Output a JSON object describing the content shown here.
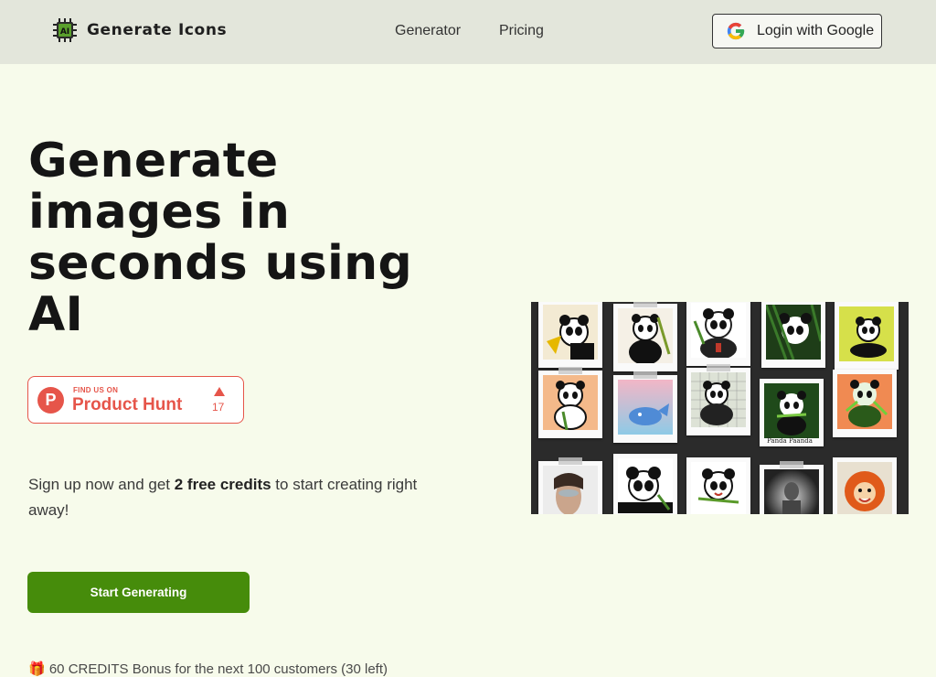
{
  "header": {
    "brand": "Generate Icons",
    "brand_icon": "ai-chip-icon",
    "nav": [
      "Generator",
      "Pricing"
    ],
    "login_label": "Login with Google",
    "login_icon": "google-icon"
  },
  "hero": {
    "title": "Generate images in seconds using AI",
    "product_hunt": {
      "small": "FIND US ON",
      "name": "Product Hunt",
      "count": "17",
      "letter": "P"
    },
    "signup_before": "Sign up now and get ",
    "signup_bold": "2 free credits",
    "signup_after": " to start creating right away!",
    "cta": "Start Generating"
  },
  "footer_strip": {
    "text": "🎁 60 CREDITS Bonus for the next 100 customers (30 left)"
  },
  "gallery": {
    "caption": "Panda Paanda",
    "accent_color": "#468c0b",
    "producthunt_color": "#e6554a"
  }
}
